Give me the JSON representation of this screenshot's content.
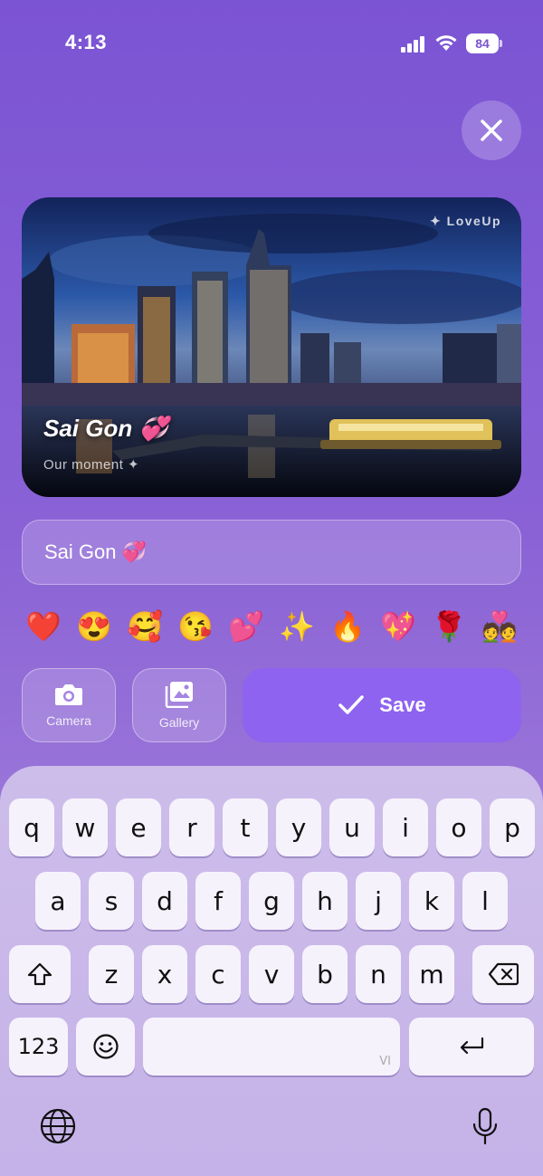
{
  "status_bar": {
    "time": "4:13",
    "battery": "84",
    "icons": [
      "signal-icon",
      "wifi-icon",
      "battery-icon"
    ]
  },
  "close_button": {
    "icon": "close-icon"
  },
  "photo_card": {
    "watermark": "✦ LoveUp",
    "title": "Sai Gon 💞",
    "subtitle": "Our moment ✦"
  },
  "caption": {
    "value": "Sai Gon 💞"
  },
  "emojis": [
    "❤️",
    "😍",
    "🥰",
    "😘",
    "💕",
    "✨",
    "🔥",
    "💖",
    "🌹",
    "💑"
  ],
  "actions": {
    "camera_label": "Camera",
    "gallery_label": "Gallery",
    "save_label": "Save"
  },
  "keyboard": {
    "row1": [
      "q",
      "w",
      "e",
      "r",
      "t",
      "y",
      "u",
      "i",
      "o",
      "p"
    ],
    "row2": [
      "a",
      "s",
      "d",
      "f",
      "g",
      "h",
      "j",
      "k",
      "l"
    ],
    "row3": [
      "z",
      "x",
      "c",
      "v",
      "b",
      "n",
      "m"
    ],
    "numbers_label": "123",
    "space_hint": "VI",
    "icons": [
      "shift-icon",
      "backspace-icon",
      "emoji-icon",
      "return-icon",
      "globe-icon",
      "microphone-icon"
    ]
  },
  "colors": {
    "background": "#7b54d4",
    "save_button": "#8e63f0",
    "keyboard": "#c9b8ea"
  }
}
